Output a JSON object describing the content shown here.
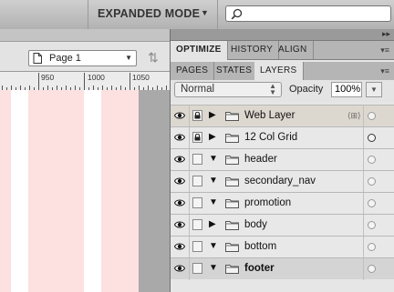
{
  "topbar": {
    "mode_label": "EXPANDED MODE",
    "search_placeholder": ""
  },
  "document": {
    "page_select": "Page 1",
    "ruler_numbers": [
      "950",
      "1000",
      "1050"
    ]
  },
  "panel": {
    "tabs_top": [
      "OPTIMIZE",
      "HISTORY",
      "ALIGN"
    ],
    "tabs_bottom": [
      "PAGES",
      "STATES",
      "LAYERS"
    ],
    "blend_mode": "Normal",
    "opacity_label": "Opacity",
    "opacity_value": "100%",
    "layers": [
      {
        "name": "Web Layer",
        "expanded": false,
        "locked": true
      },
      {
        "name": "12 Col Grid",
        "expanded": false,
        "locked": true
      },
      {
        "name": "header",
        "expanded": true,
        "locked": false
      },
      {
        "name": "secondary_nav",
        "expanded": true,
        "locked": false
      },
      {
        "name": "promotion",
        "expanded": true,
        "locked": false
      },
      {
        "name": "body",
        "expanded": false,
        "locked": false
      },
      {
        "name": "bottom",
        "expanded": true,
        "locked": false
      },
      {
        "name": "footer",
        "expanded": true,
        "locked": false,
        "selected": true
      }
    ]
  },
  "colors": {
    "grid_column": "#fde0e0",
    "panel_bg": "#e6e6e6",
    "selected_row": "#d4d4d4"
  }
}
